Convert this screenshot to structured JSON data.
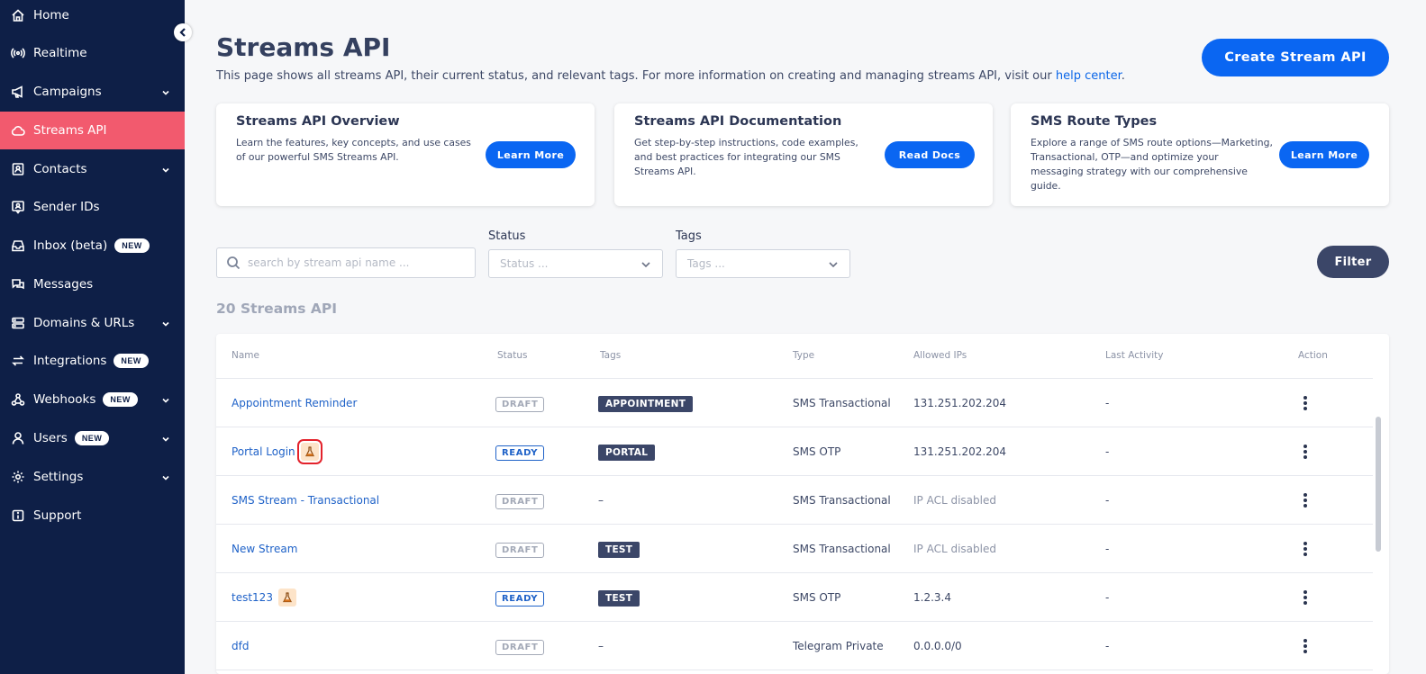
{
  "sidebar": {
    "items": [
      {
        "label": "Home",
        "icon": "home-icon"
      },
      {
        "label": "Realtime",
        "icon": "broadcast-icon"
      },
      {
        "label": "Campaigns",
        "icon": "megaphone-icon",
        "chevron": true
      },
      {
        "label": "Streams API",
        "icon": "cloud-icon",
        "active": true
      },
      {
        "label": "Contacts",
        "icon": "contact-card-icon",
        "chevron": true
      },
      {
        "label": "Sender IDs",
        "icon": "id-badge-icon"
      },
      {
        "label": "Inbox (beta)",
        "icon": "inbox-icon",
        "badge": "NEW"
      },
      {
        "label": "Messages",
        "icon": "chat-icon"
      },
      {
        "label": "Domains & URLs",
        "icon": "server-icon",
        "chevron": true
      },
      {
        "label": "Integrations",
        "icon": "swap-icon",
        "badge": "NEW"
      },
      {
        "label": "Webhooks",
        "icon": "webhook-icon",
        "badge": "NEW",
        "chevron": true
      },
      {
        "label": "Users",
        "icon": "user-icon",
        "badge": "NEW",
        "chevron": true
      },
      {
        "label": "Settings",
        "icon": "gear-icon",
        "chevron": true
      },
      {
        "label": "Support",
        "icon": "info-icon"
      }
    ]
  },
  "header": {
    "title": "Streams API",
    "desc": "This page shows all streams API, their current status, and relevant tags. For more information on creating and managing streams API, visit our ",
    "help_link": "help center",
    "desc_end": ".",
    "create_label": "Create Stream API"
  },
  "cards": [
    {
      "title": "Streams API Overview",
      "text": "Learn the features, key concepts, and use cases of our powerful SMS Streams API.",
      "button": "Learn More"
    },
    {
      "title": "Streams API Documentation",
      "text": "Get step-by-step instructions, code examples, and best practices for integrating our SMS Streams API.",
      "button": "Read Docs"
    },
    {
      "title": "SMS Route Types",
      "text": "Explore a range of SMS route options—Marketing, Transactional, OTP—and optimize your messaging strategy with our comprehensive guide.",
      "button": "Learn More"
    }
  ],
  "filters": {
    "search_placeholder": "search by stream api name ...",
    "status_label": "Status",
    "status_placeholder": "Status ...",
    "tags_label": "Tags",
    "tags_placeholder": "Tags ...",
    "filter_label": "Filter"
  },
  "count_title": "20 Streams API",
  "table": {
    "headers": [
      "Name",
      "Status",
      "Tags",
      "Type",
      "Allowed IPs",
      "Last Activity",
      "Action"
    ],
    "rows": [
      {
        "name": "Appointment Reminder",
        "beaker": false,
        "status": "DRAFT",
        "tag": "APPOINTMENT",
        "type": "SMS Transactional",
        "ips": "131.251.202.204",
        "ips_muted": false,
        "last": "-"
      },
      {
        "name": "Portal Login",
        "beaker": true,
        "highlight": true,
        "status": "READY",
        "tag": "PORTAL",
        "type": "SMS OTP",
        "ips": "131.251.202.204",
        "ips_muted": false,
        "last": "-"
      },
      {
        "name": "SMS Stream - Transactional",
        "beaker": false,
        "status": "DRAFT",
        "tag": "",
        "no_tag": "–",
        "type": "SMS Transactional",
        "ips": "IP ACL disabled",
        "ips_muted": true,
        "last": "-"
      },
      {
        "name": "New Stream",
        "beaker": false,
        "status": "DRAFT",
        "tag": "TEST",
        "type": "SMS Transactional",
        "ips": "IP ACL disabled",
        "ips_muted": true,
        "last": "-"
      },
      {
        "name": "test123",
        "beaker": true,
        "status": "READY",
        "tag": "TEST",
        "type": "SMS OTP",
        "ips": "1.2.3.4",
        "ips_muted": false,
        "last": "-"
      },
      {
        "name": "dfd",
        "beaker": false,
        "status": "DRAFT",
        "tag": "",
        "no_tag": "–",
        "type": "Telegram Private",
        "ips": "0.0.0.0/0",
        "ips_muted": false,
        "last": "-"
      }
    ]
  },
  "colors": {
    "sidebar_bg": "#0e1f47",
    "active": "#f25a6e",
    "primary": "#0a66f2",
    "tag_bg": "#3b4668"
  }
}
